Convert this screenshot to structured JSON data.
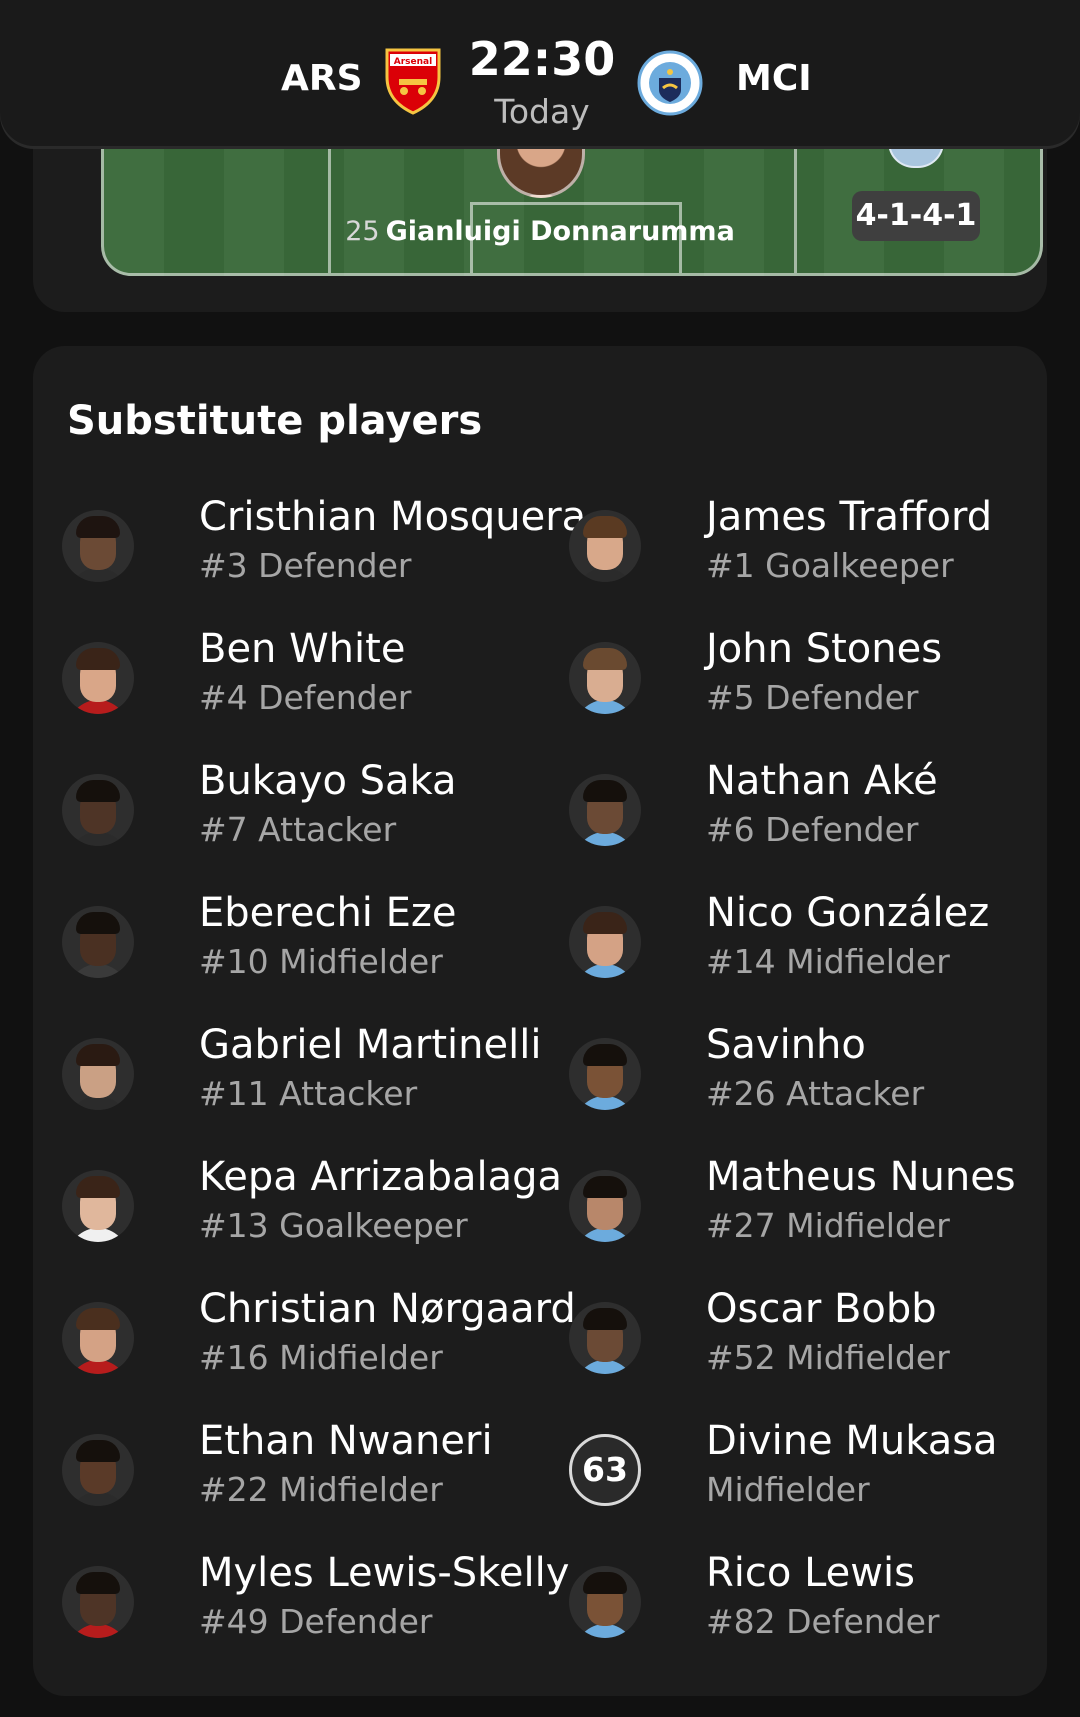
{
  "header": {
    "home_code": "ARS",
    "away_code": "MCI",
    "time": "22:30",
    "date": "Today",
    "home_crest_text": "Arsenal",
    "away_crest_text": "MANCHESTER CITY"
  },
  "pitch": {
    "goalkeeper_number": "25",
    "goalkeeper_name": "Gianluigi Donnarumma",
    "formation": "4-1-4-1"
  },
  "substitutes": {
    "title": "Substitute players",
    "home": [
      {
        "name": "Cristhian Mosquera",
        "info": "#3 Defender",
        "skin": "#6b4a35",
        "hair": "#1e1410",
        "shirt": "#2b2b2b"
      },
      {
        "name": "Ben White",
        "info": "#4 Defender",
        "skin": "#d9a688",
        "hair": "#3a2418",
        "shirt": "#b71c1c"
      },
      {
        "name": "Bukayo Saka",
        "info": "#7 Attacker",
        "skin": "#4e3426",
        "hair": "#15100c",
        "shirt": "#2b2b2b"
      },
      {
        "name": "Eberechi Eze",
        "info": "#10 Midfielder",
        "skin": "#4a3022",
        "hair": "#15100c",
        "shirt": "#3a3a3a"
      },
      {
        "name": "Gabriel Martinelli",
        "info": "#11 Attacker",
        "skin": "#caa084",
        "hair": "#2a1a12",
        "shirt": "#2b2b2b"
      },
      {
        "name": "Kepa Arrizabalaga",
        "info": "#13 Goalkeeper",
        "skin": "#e0b79c",
        "hair": "#3a2418",
        "shirt": "#f0f0f0"
      },
      {
        "name": "Christian Nørgaard",
        "info": "#16 Midfielder",
        "skin": "#d4a285",
        "hair": "#4a2f1e",
        "shirt": "#b71c1c"
      },
      {
        "name": "Ethan Nwaneri",
        "info": "#22 Midfielder",
        "skin": "#5a3a28",
        "hair": "#15100c",
        "shirt": "#2b2b2b"
      },
      {
        "name": "Myles Lewis-Skelly",
        "info": "#49 Defender",
        "skin": "#4e3426",
        "hair": "#15100c",
        "shirt": "#b71c1c"
      }
    ],
    "away": [
      {
        "name": "James Trafford",
        "info": "#1 Goalkeeper",
        "skin": "#d8a88a",
        "hair": "#5a3a22",
        "shirt": "#2b2b2b"
      },
      {
        "name": "John Stones",
        "info": "#5 Defender",
        "skin": "#d9ad91",
        "hair": "#6a4a30",
        "shirt": "#6cabdd"
      },
      {
        "name": "Nathan Aké",
        "info": "#6 Defender",
        "skin": "#6b4a35",
        "hair": "#15100c",
        "shirt": "#6cabdd"
      },
      {
        "name": "Nico González",
        "info": "#14 Midfielder",
        "skin": "#d4a285",
        "hair": "#3a2418",
        "shirt": "#6cabdd"
      },
      {
        "name": "Savinho",
        "info": "#26 Attacker",
        "skin": "#7a5236",
        "hair": "#15100c",
        "shirt": "#6cabdd"
      },
      {
        "name": "Matheus Nunes",
        "info": "#27 Midfielder",
        "skin": "#b8876a",
        "hair": "#15100c",
        "shirt": "#6cabdd"
      },
      {
        "name": "Oscar Bobb",
        "info": "#52 Midfielder",
        "skin": "#6b4a35",
        "hair": "#15100c",
        "shirt": "#6cabdd"
      },
      {
        "name": "Divine Mukasa",
        "info": "Midfielder",
        "avatar_text": "63"
      },
      {
        "name": "Rico Lewis",
        "info": "#82 Defender",
        "skin": "#7a5236",
        "hair": "#15100c",
        "shirt": "#6cabdd"
      }
    ]
  },
  "colors": {
    "background": "#111111",
    "card": "#1c1c1c",
    "pitch": "#3b6b3b",
    "secondary_text": "#a6a6a6",
    "arsenal_red": "#db0007",
    "city_blue": "#6cabdd"
  }
}
